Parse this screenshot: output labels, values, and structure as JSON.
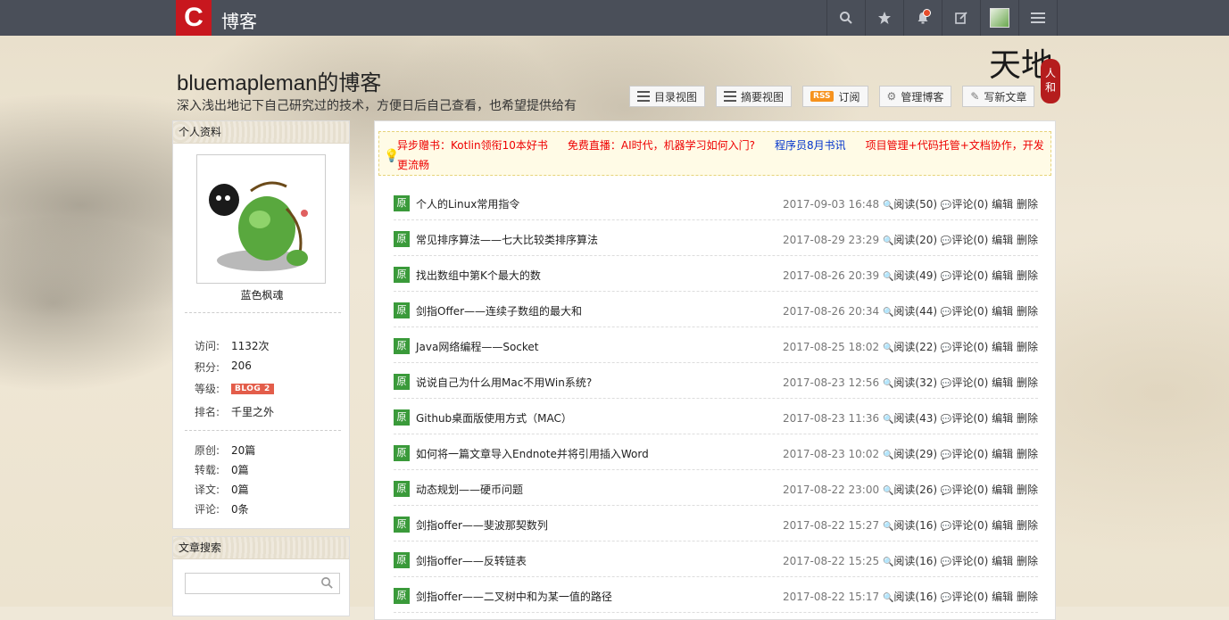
{
  "topbar": {
    "logo": "C",
    "site": "博客",
    "icons": [
      "search-icon",
      "star-icon",
      "bell-icon",
      "edit-icon",
      "avatar",
      "menu-icon"
    ]
  },
  "header": {
    "title": "bluemapleman的博客",
    "subtitle": "深入浅出地记下自己研究过的技术，方便日后自己查看，也希望提供给有",
    "buttons": {
      "catalog": "目录视图",
      "summary": "摘要视图",
      "rss_badge": "RSS",
      "subscribe": "订阅",
      "manage": "管理博客",
      "write": "写新文章"
    },
    "seal": {
      "big": "天地",
      "small": "人和"
    }
  },
  "sidebar": {
    "profile_title": "个人资料",
    "nickname": "蓝色枫魂",
    "stats": [
      {
        "label": "访问:",
        "value": "1132次"
      },
      {
        "label": "积分:",
        "value": "206"
      },
      {
        "label": "等级:",
        "value": "BLOG 2"
      },
      {
        "label": "排名:",
        "value": "千里之外"
      }
    ],
    "counts": [
      {
        "label": "原创:",
        "value": "20篇"
      },
      {
        "label": "转载:",
        "value": "0篇"
      },
      {
        "label": "译文:",
        "value": "0篇"
      },
      {
        "label": "评论:",
        "value": "0条"
      }
    ],
    "search_title": "文章搜索",
    "search_placeholder": ""
  },
  "notice": [
    {
      "text": "异步赠书：Kotlin领衔10本好书",
      "color": "red"
    },
    {
      "text": "免费直播：AI时代，机器学习如何入门?",
      "color": "red"
    },
    {
      "text": "程序员8月书讯",
      "color": "blue"
    },
    {
      "text": "项目管理+代码托管+文档协作，开发更流畅",
      "color": "red"
    }
  ],
  "articles": [
    {
      "tag": "原",
      "title": "个人的Linux常用指令",
      "date": "2017-09-03 16:48",
      "reads": "阅读(50)",
      "comments": "评论(0)"
    },
    {
      "tag": "原",
      "title": "常见排序算法——七大比较类排序算法",
      "date": "2017-08-29 23:29",
      "reads": "阅读(20)",
      "comments": "评论(0)"
    },
    {
      "tag": "原",
      "title": "找出数组中第K个最大的数",
      "date": "2017-08-26 20:39",
      "reads": "阅读(49)",
      "comments": "评论(0)"
    },
    {
      "tag": "原",
      "title": "剑指Offer——连续子数组的最大和",
      "date": "2017-08-26 20:34",
      "reads": "阅读(44)",
      "comments": "评论(0)"
    },
    {
      "tag": "原",
      "title": "Java网络编程——Socket",
      "date": "2017-08-25 18:02",
      "reads": "阅读(22)",
      "comments": "评论(0)"
    },
    {
      "tag": "原",
      "title": "说说自己为什么用Mac不用Win系统?",
      "date": "2017-08-23 12:56",
      "reads": "阅读(32)",
      "comments": "评论(0)"
    },
    {
      "tag": "原",
      "title": "Github桌面版使用方式（MAC）",
      "date": "2017-08-23 11:36",
      "reads": "阅读(43)",
      "comments": "评论(0)"
    },
    {
      "tag": "原",
      "title": "如何将一篇文章导入Endnote并将引用插入Word",
      "date": "2017-08-23 10:02",
      "reads": "阅读(29)",
      "comments": "评论(0)"
    },
    {
      "tag": "原",
      "title": "动态规划——硬币问题",
      "date": "2017-08-22 23:00",
      "reads": "阅读(26)",
      "comments": "评论(0)"
    },
    {
      "tag": "原",
      "title": "剑指offer——斐波那契数列",
      "date": "2017-08-22 15:27",
      "reads": "阅读(16)",
      "comments": "评论(0)"
    },
    {
      "tag": "原",
      "title": "剑指offer——反转链表",
      "date": "2017-08-22 15:25",
      "reads": "阅读(16)",
      "comments": "评论(0)"
    },
    {
      "tag": "原",
      "title": "剑指offer——二叉树中和为某一值的路径",
      "date": "2017-08-22 15:17",
      "reads": "阅读(16)",
      "comments": "评论(0)"
    }
  ],
  "row_actions": {
    "edit": "编辑",
    "delete": "删除"
  },
  "colors": {
    "topbar": "#4a4f59",
    "logo": "#c8171e",
    "tag": "#3a9a3a",
    "link_red": "#e00",
    "link_blue": "#03c"
  }
}
